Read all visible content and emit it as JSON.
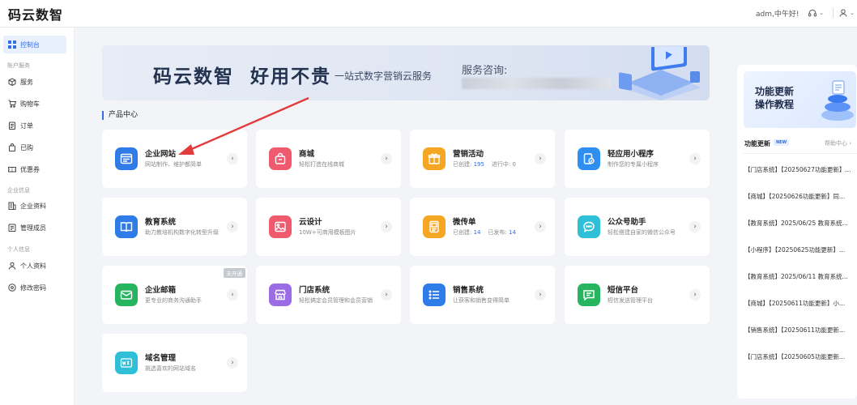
{
  "header": {
    "logo": "码云数智",
    "greeting": "adm,中午好!",
    "support_icon": "headset-icon",
    "user_icon": "user-icon"
  },
  "sidebar": {
    "items": [
      {
        "label": "控制台",
        "icon": "grid-icon",
        "active": true
      },
      {
        "label": "服务",
        "icon": "box-icon"
      },
      {
        "label": "购物车",
        "icon": "cart-icon"
      },
      {
        "label": "订单",
        "icon": "order-icon"
      },
      {
        "label": "已购",
        "icon": "bag-icon"
      },
      {
        "label": "优惠券",
        "icon": "coupon-icon"
      },
      {
        "label": "企业资料",
        "icon": "building-icon"
      },
      {
        "label": "管理成员",
        "icon": "members-icon"
      },
      {
        "label": "个人资料",
        "icon": "person-icon"
      },
      {
        "label": "修改密码",
        "icon": "lock-icon"
      }
    ],
    "groups": [
      "账户服务",
      "企业信息",
      "个人信息"
    ]
  },
  "banner": {
    "main": "码云数智  好用不贵",
    "sub": "一站式数字营销云服务",
    "consult": "服务咨询:"
  },
  "section_title": "产品中心",
  "cards": [
    {
      "title": "企业网站",
      "desc": "网站制作、维护都简单",
      "color": "#2f7be8"
    },
    {
      "title": "商城",
      "desc": "轻松打造在线商城",
      "color": "#ef5a6f"
    },
    {
      "title": "营销活动",
      "desc_a": "已创建:",
      "num_a": "195",
      "desc_b": "进行中:",
      "num_b": "0",
      "color": "#f5a623"
    },
    {
      "title": "轻应用小程序",
      "desc": "制作您的专属小程序",
      "color": "#2f8ff0"
    },
    {
      "title": "教育系统",
      "desc": "助力教培机构数字化转型升级",
      "color": "#2f7be8"
    },
    {
      "title": "云设计",
      "desc": "10W+可商用模板图片",
      "color": "#ef5a6f"
    },
    {
      "title": "微传单",
      "desc_a": "已创建:",
      "num_a": "14",
      "desc_b": "已发布:",
      "num_b": "14",
      "color": "#f5a623"
    },
    {
      "title": "公众号助手",
      "desc": "轻松搭建自家的微信公众号",
      "color": "#2fbfd6"
    },
    {
      "title": "企业邮箱",
      "desc": "更专业的商务沟通助手",
      "color": "#27b45f",
      "badge": "未开通"
    },
    {
      "title": "门店系统",
      "desc": "轻松搞定会员管理和会员营销",
      "color": "#9b6ce6"
    },
    {
      "title": "销售系统",
      "desc": "让获客和销售变得简单",
      "color": "#2f7be8"
    },
    {
      "title": "短信平台",
      "desc": "短信发送管理平台",
      "color": "#27b45f"
    },
    {
      "title": "域名管理",
      "desc": "挑选喜欢的网站域名",
      "color": "#2fbfd6"
    }
  ],
  "promo": {
    "line1": "功能更新",
    "line2": "操作教程"
  },
  "updates": {
    "title": "功能更新",
    "new_badge": "NEW",
    "help": "帮助中心 ›",
    "items": [
      "【门店系统】【20250627功能更新】...",
      "【商城】【20250626功能更新】同...",
      "【教育系统】2025/06/25 教育系统...",
      "【小程序】【20250625功能更新】...",
      "【教育系统】2025/06/11 教育系统...",
      "【商城】【20250611功能更新】小...",
      "【销售系统】【20250611功能更新...",
      "【门店系统】【20250605功能更新..."
    ]
  }
}
